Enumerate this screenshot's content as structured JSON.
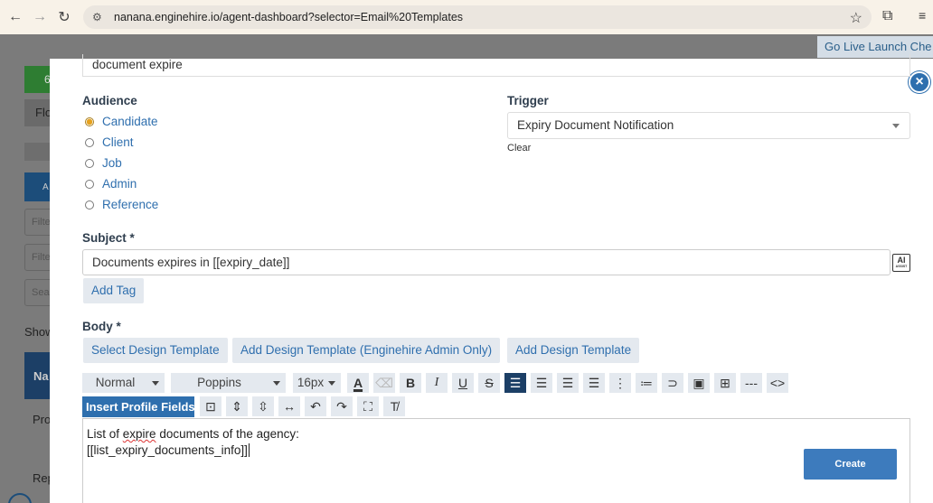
{
  "browser": {
    "url": "nanana.enginehire.io/agent-dashboard?selector=Email%20Templates"
  },
  "background": {
    "go_live": "Go Live Launch Che",
    "green_btn": "6",
    "grey_btn": "Flo",
    "blue_btn": "A",
    "filter1": "Filte",
    "filter2": "Filte",
    "search": "Sea",
    "show": "Show",
    "table_head": "Na",
    "row1": "Pro",
    "row2": "Rep"
  },
  "modal": {
    "name_value": "document expire",
    "audience_label": "Audience",
    "audience_options": [
      "Candidate",
      "Client",
      "Job",
      "Admin",
      "Reference"
    ],
    "audience_selected": "Candidate",
    "trigger_label": "Trigger",
    "trigger_value": "Expiry Document Notification",
    "clear": "Clear",
    "subject_label": "Subject *",
    "subject_value": "Documents expires in [[expiry_date]]",
    "ai_label": "AI",
    "ai_sub": "ASSIST",
    "add_tag": "Add Tag",
    "body_label": "Body *",
    "select_design": "Select Design Template",
    "add_design_admin": "Add Design Template (Enginehire Admin Only)",
    "add_design": "Add Design Template",
    "toolbar": {
      "format": "Normal",
      "font": "Poppins",
      "size": "16px",
      "insert_profile_fields": "Insert Profile Fields"
    },
    "body_line1_pre": "List of ",
    "body_line1_word": "expire",
    "body_line1_post": " documents of the agency:",
    "body_line2": "[[list_expiry_documents_info]]",
    "create": "Create"
  }
}
